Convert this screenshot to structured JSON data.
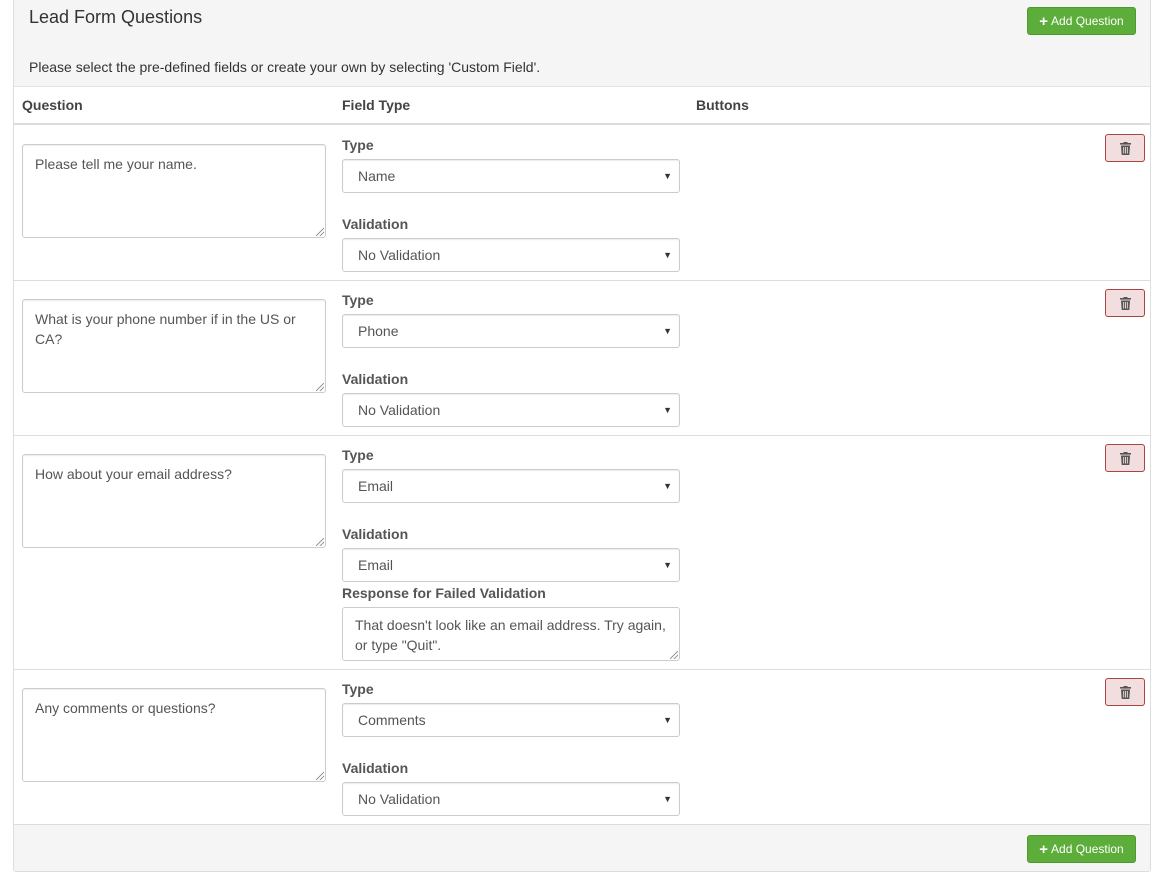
{
  "panel": {
    "title": "Lead Form Questions",
    "description": "Please select the pre-defined fields or create your own by selecting 'Custom Field'.",
    "add_button_label": "Add Question"
  },
  "columns": {
    "question": "Question",
    "field_type": "Field Type",
    "buttons": "Buttons"
  },
  "labels": {
    "type": "Type",
    "validation": "Validation",
    "failed_response": "Response for Failed Validation"
  },
  "questions": [
    {
      "text": "Please tell me your name.",
      "type": "Name",
      "validation": "No Validation"
    },
    {
      "text": "What is your phone number if in the US or CA?",
      "type": "Phone",
      "validation": "No Validation"
    },
    {
      "text": "How about your email address?",
      "type": "Email",
      "validation": "Email",
      "failed_response": "That doesn't look like an email address.  Try again, or type \"Quit\"."
    },
    {
      "text": "Any comments or questions?",
      "type": "Comments",
      "validation": "No Validation"
    }
  ],
  "icons": {
    "add": "plus-icon",
    "delete": "trash-icon",
    "select": "caret-down-icon"
  },
  "colors": {
    "add_button": "#5cad3a",
    "delete_button_bg": "#f2dede",
    "delete_button_border": "#a94442"
  }
}
